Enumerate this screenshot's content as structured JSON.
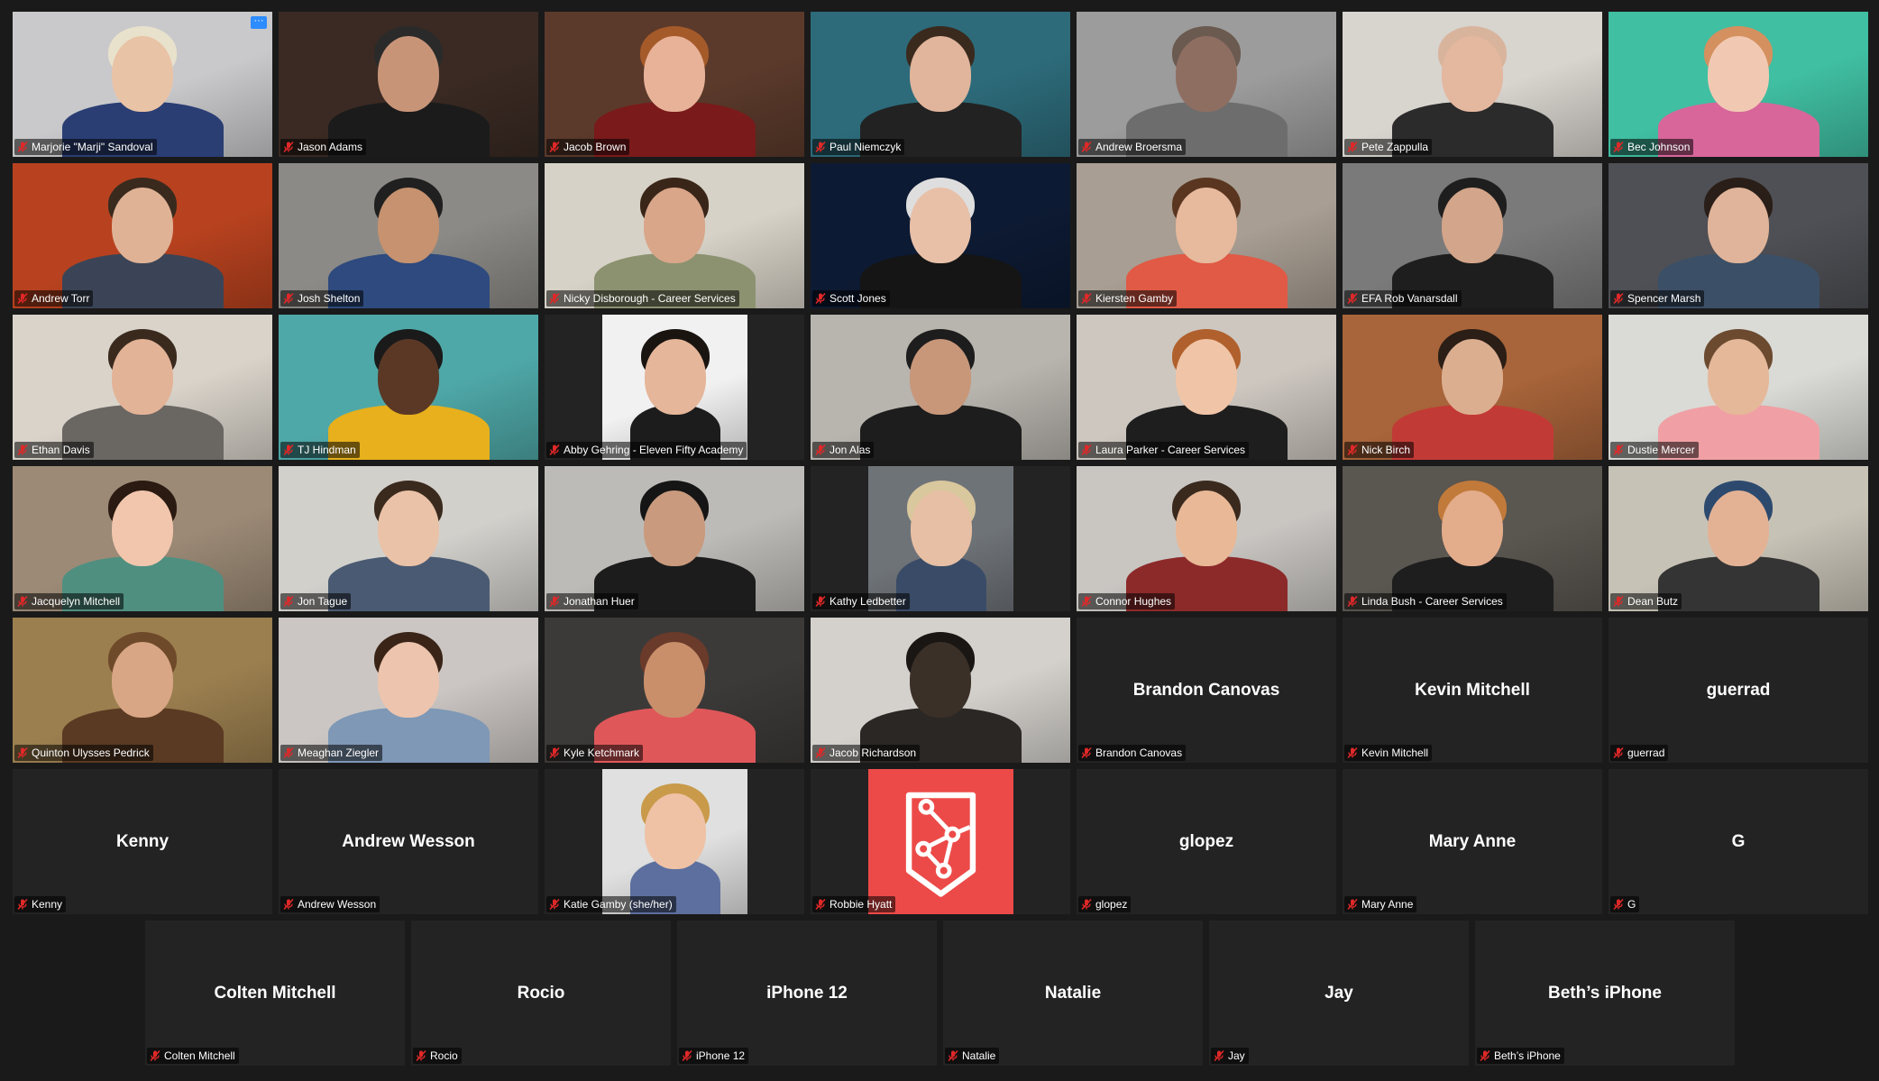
{
  "meeting": {
    "participants": [
      {
        "name": "Marjorie \"Marji\" Sandoval",
        "video": true,
        "bg": "#c9c9cb",
        "skin": "#e9c3a6",
        "shirt": "#2a3e74",
        "hair": "#e8e2cc"
      },
      {
        "name": "Jason Adams",
        "video": true,
        "bg": "#3a2a23",
        "skin": "#c89478",
        "shirt": "#1b1b1b",
        "hair": "#2a2a2a"
      },
      {
        "name": "Jacob Brown",
        "video": true,
        "bg": "#5b3a2b",
        "skin": "#e8b299",
        "shirt": "#7a1a1a",
        "hair": "#a55a2a"
      },
      {
        "name": "Paul Niemczyk",
        "video": true,
        "bg": "#2d6b7a",
        "skin": "#e0b59b",
        "shirt": "#222222",
        "hair": "#3a2a1e"
      },
      {
        "name": "Andrew Broersma",
        "video": true,
        "bg": "#9c9c9c",
        "skin": "#8f6e62",
        "shirt": "#6d6d6d",
        "hair": "#6b5a50"
      },
      {
        "name": "Pete Zappulla",
        "video": true,
        "bg": "#d8d4ce",
        "skin": "#e4b79f",
        "shirt": "#2b2b2b",
        "hair": "#d9b49d"
      },
      {
        "name": "Bec Johnson",
        "video": true,
        "bg": "#40bfa2",
        "skin": "#f1c9b3",
        "shirt": "#d8669a",
        "hair": "#d4905e"
      },
      {
        "name": "Andrew Torr",
        "video": true,
        "bg": "#b8421f",
        "skin": "#e0b295",
        "shirt": "#3b4456",
        "hair": "#3a2a1e"
      },
      {
        "name": "Josh Shelton",
        "video": true,
        "bg": "#8c8a86",
        "skin": "#c6926f",
        "shirt": "#2e4a7e",
        "hair": "#202020"
      },
      {
        "name": "Nicky Disborough - Career Services",
        "video": true,
        "bg": "#d7d2c7",
        "skin": "#d9a68a",
        "shirt": "#8c9270",
        "hair": "#3a2618"
      },
      {
        "name": "Scott Jones",
        "video": true,
        "bg": "#0d1a33",
        "skin": "#e8c0a8",
        "shirt": "#151515",
        "hair": "#dedede"
      },
      {
        "name": "Kiersten Gamby",
        "video": true,
        "bg": "#a89e93",
        "skin": "#e7b99d",
        "shirt": "#e05a45",
        "hair": "#5a3620"
      },
      {
        "name": "EFA Rob Vanarsdall",
        "video": true,
        "bg": "#7a7a7a",
        "skin": "#d3a58a",
        "shirt": "#1e1e1e",
        "hair": "#1e1e1e"
      },
      {
        "name": "Spencer Marsh",
        "video": true,
        "bg": "#4f5055",
        "skin": "#e0b49a",
        "shirt": "#3b4f66",
        "hair": "#2a1e18"
      },
      {
        "name": "Ethan Davis",
        "video": true,
        "bg": "#d9d3ca",
        "skin": "#e3b397",
        "shirt": "#6a6662",
        "hair": "#3a2a1e"
      },
      {
        "name": "TJ Hindman",
        "video": true,
        "bg": "#4fa8a8",
        "skin": "#5b3826",
        "shirt": "#e7b01c",
        "hair": "#1a1a1a"
      },
      {
        "name": "Abby Gehring - Eleven Fifty Academy",
        "video": true,
        "bg": "#f1f1f1",
        "skin": "#e5b69a",
        "shirt": "#1c1c1c",
        "hair": "#1a1410",
        "inset": true
      },
      {
        "name": "Jon Alas",
        "video": true,
        "bg": "#b8b4ae",
        "skin": "#c8977a",
        "shirt": "#1d1d1d",
        "hair": "#1d1d1d"
      },
      {
        "name": "Laura Parker - Career Services",
        "video": true,
        "bg": "#cdc7c0",
        "skin": "#f0c4a6",
        "shirt": "#1e1e1e",
        "hair": "#b0602c"
      },
      {
        "name": "Nick Birch",
        "video": true,
        "bg": "#a8643a",
        "skin": "#dcae90",
        "shirt": "#c23a35",
        "hair": "#2a1e16"
      },
      {
        "name": "Dustie Mercer",
        "video": true,
        "bg": "#dadbd6",
        "skin": "#e5b89a",
        "shirt": "#f0a0a4",
        "hair": "#6b4a30"
      },
      {
        "name": "Jacquelyn Mitchell",
        "video": true,
        "bg": "#9c8a76",
        "skin": "#f1c6ad",
        "shirt": "#4f8f80",
        "hair": "#2a1a12"
      },
      {
        "name": "Jon Tague",
        "video": true,
        "bg": "#d2d0cb",
        "skin": "#eac2a7",
        "shirt": "#4a5a72",
        "hair": "#3a2a1e"
      },
      {
        "name": "Jonathan Huer",
        "video": true,
        "bg": "#bdbbb7",
        "skin": "#c99a7d",
        "shirt": "#1c1c1c",
        "hair": "#151515",
        "speaking": true
      },
      {
        "name": "Kathy Ledbetter",
        "video": true,
        "bg": "#6e7378",
        "skin": "#e7bfa4",
        "shirt": "#394b66",
        "hair": "#d9c79d",
        "inset": true
      },
      {
        "name": "Connor Hughes",
        "video": true,
        "bg": "#c9c6c2",
        "skin": "#e9b896",
        "shirt": "#8c2a2a",
        "hair": "#3a2a1e"
      },
      {
        "name": "Linda Bush - Career Services",
        "video": true,
        "bg": "#5a5650",
        "skin": "#e3ac8b",
        "shirt": "#1e1e1e",
        "hair": "#c27a3a"
      },
      {
        "name": "Dean Butz",
        "video": true,
        "bg": "#c7c2b6",
        "skin": "#e3b295",
        "shirt": "#343434",
        "hair": "#2d4a6e"
      },
      {
        "name": "Quinton Ulysses Pedrick",
        "video": true,
        "bg": "#9b7f4f",
        "skin": "#d8a685",
        "shirt": "#5a3a22",
        "hair": "#6e4a2a"
      },
      {
        "name": "Meaghan Ziegler",
        "video": true,
        "bg": "#cbc6c3",
        "skin": "#edc4ad",
        "shirt": "#7e98b6",
        "hair": "#3a2418"
      },
      {
        "name": "Kyle Ketchmark",
        "video": true,
        "bg": "#3c3a38",
        "skin": "#c98f6b",
        "shirt": "#e0575a",
        "hair": "#6a3a2a"
      },
      {
        "name": "Jacob Richardson",
        "video": true,
        "bg": "#d4d1cc",
        "skin": "#3a3028",
        "shirt": "#2a2724",
        "hair": "#1a1614"
      },
      {
        "name": "Brandon Canovas",
        "video": false
      },
      {
        "name": "Kevin Mitchell",
        "video": false
      },
      {
        "name": "guerrad",
        "video": false
      },
      {
        "name": "Kenny",
        "video": false
      },
      {
        "name": "Andrew Wesson",
        "video": false
      },
      {
        "name": "Katie Gamby (she/her)",
        "video": true,
        "bg": "#dfe0df",
        "skin": "#efc2a6",
        "shirt": "#5d6f9e",
        "hair": "#c99a4a",
        "inset": true
      },
      {
        "name": "Robbie Hyatt",
        "video": false,
        "logo": true
      },
      {
        "name": "glopez",
        "video": false
      },
      {
        "name": "Mary Anne",
        "video": false
      },
      {
        "name": "G",
        "video": false
      },
      {
        "name": "Colten Mitchell",
        "video": false
      },
      {
        "name": "Rocio",
        "video": false
      },
      {
        "name": "iPhone 12",
        "video": false
      },
      {
        "name": "Natalie",
        "video": false
      },
      {
        "name": "Jay",
        "video": false
      },
      {
        "name": "Beth’s iPhone",
        "video": false
      }
    ],
    "more_button_label": "···",
    "icons": {
      "mic_muted": "mic-muted-icon",
      "more": "more-options-icon",
      "logo": "avatar-logo-icon"
    },
    "colors": {
      "mic_muted": "#e02828",
      "active_speaker": "#d7e04d",
      "logo_bg": "#ec4a48",
      "more_btn": "#2d8cff"
    }
  }
}
